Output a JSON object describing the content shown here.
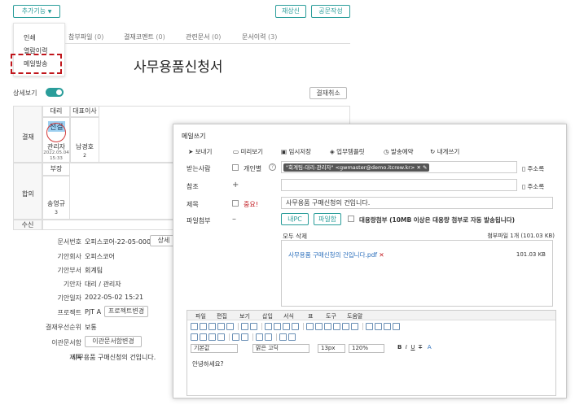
{
  "toolbar": {
    "more_label": "추가기능",
    "redraft_label": "재상신",
    "publish_label": "공문작성"
  },
  "dropdown": {
    "items": [
      "인쇄",
      "열람이력",
      "메일발송"
    ]
  },
  "tabs": [
    {
      "label": "참부파일",
      "count": "(0)"
    },
    {
      "label": "결재코멘트",
      "count": "(0)"
    },
    {
      "label": "관련문서",
      "count": "(0)"
    },
    {
      "label": "문서이력",
      "count": "(3)"
    }
  ],
  "doc": {
    "title": "사무용품신청서",
    "detail_label": "상세보기",
    "cancel_label": "결재취소"
  },
  "approval": {
    "row_label": "결재",
    "col1_title": "대리",
    "col2_title": "대표이사",
    "stamp": "전결",
    "col1_name": "관리자",
    "col1_date": "2022.05.04",
    "col1_time": "15:33",
    "col2_name": "남경호",
    "col2_num": "2",
    "agree_label": "합의",
    "agree_title": "부장",
    "agree_name": "송영규",
    "agree_num": "3",
    "recv_label": "수신"
  },
  "info": {
    "rows": [
      {
        "label": "문서번호",
        "value": "오피스코어-22-05-0001"
      },
      {
        "label": "기안회사",
        "value": "오피스코어"
      },
      {
        "label": "기안부서",
        "value": "회계팀"
      },
      {
        "label": "기안자",
        "value": "대리 / 관리자"
      },
      {
        "label": "기안일자",
        "value": "2022-05-02 15:21"
      },
      {
        "label": "프로젝트",
        "value": "PJT A"
      },
      {
        "label": "결재우선순위",
        "value": "보통"
      },
      {
        "label": "이관문서함",
        "value": ""
      },
      {
        "label": "제목",
        "value": "사무용품 구매신청의 건입니다."
      }
    ],
    "settings_btn": "상세",
    "project_btn": "프로젝트변경",
    "transfer_btn": "이관문서함변경"
  },
  "mail": {
    "title": "메일쓰기",
    "actions": [
      "보내기",
      "미리보기",
      "임시저장",
      "업무템플릿",
      "발송예약",
      "내게쓰기"
    ],
    "to_label": "받는사람",
    "personal_label": "개인별",
    "recipient": "\"회계팀-대리-관리자\" <gwmaster@demo.itcrew.kr>",
    "addrbook_label": "주소록",
    "cc_label": "참조",
    "subject_label": "제목",
    "important_label": "중요!",
    "subject_value": "사무용품 구매신청의 건입니다.",
    "attach_label": "파일첨부",
    "mypc_label": "내PC",
    "filebox_label": "파일함",
    "bulk_label": "대용량첨부 (10MB 이상은 대용량 첨부로 자동 발송됩니다)",
    "delete_all": "모두 삭제",
    "attach_summary": "첨부파일   1개 (101.03 KB)",
    "file_name": "사무용품 구매신청의 건입니다.pdf",
    "file_size": "101.03 KB",
    "menus": [
      "파일",
      "편집",
      "보기",
      "삽입",
      "서식",
      "표",
      "도구",
      "도움말"
    ],
    "style_select": "기본값",
    "font_select": "맑은 고딕",
    "size_select": "13px",
    "zoom_select": "120%",
    "body_text": "안녕하세요?"
  },
  "colors": {
    "accent": "#2a9d9a",
    "highlight_red": "#c0151b",
    "link_blue": "#2a6ebb"
  }
}
